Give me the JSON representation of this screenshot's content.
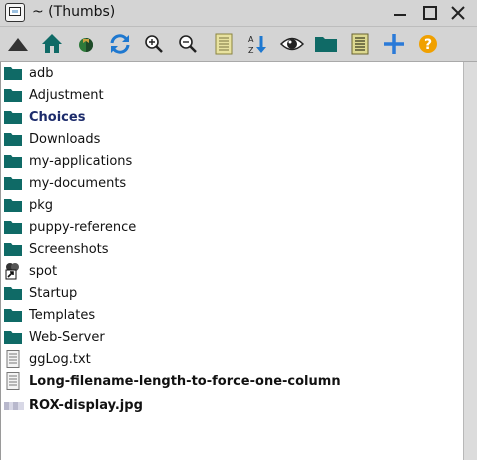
{
  "window": {
    "title": "~ (Thumbs)",
    "controls": [
      "minimize",
      "maximize",
      "close"
    ]
  },
  "toolbar": {
    "buttons": [
      {
        "name": "up-icon",
        "tooltip_hidden": true
      },
      {
        "name": "home-icon"
      },
      {
        "name": "bookmarks-icon"
      },
      {
        "name": "refresh-icon"
      },
      {
        "name": "zoom-in-icon"
      },
      {
        "name": "zoom-out-icon"
      },
      {
        "name": "list-view-icon"
      },
      {
        "name": "sort-icon",
        "glyph": "A Z"
      },
      {
        "name": "show-hidden-icon"
      },
      {
        "name": "folder-icon"
      },
      {
        "name": "details-icon"
      },
      {
        "name": "add-icon"
      },
      {
        "name": "help-icon",
        "glyph": "?"
      }
    ]
  },
  "files": [
    {
      "name": "adb",
      "type": "folder"
    },
    {
      "name": "Adjustment",
      "type": "folder"
    },
    {
      "name": "Choices",
      "type": "folder",
      "style": "bold-selected"
    },
    {
      "name": "Downloads",
      "type": "folder"
    },
    {
      "name": "my-applications",
      "type": "folder"
    },
    {
      "name": "my-documents",
      "type": "folder"
    },
    {
      "name": "pkg",
      "type": "folder"
    },
    {
      "name": "puppy-reference",
      "type": "folder"
    },
    {
      "name": "Screenshots",
      "type": "folder"
    },
    {
      "name": "spot",
      "type": "symlink"
    },
    {
      "name": "Startup",
      "type": "folder"
    },
    {
      "name": "Templates",
      "type": "folder"
    },
    {
      "name": "Web-Server",
      "type": "folder"
    },
    {
      "name": "ggLog.txt",
      "type": "text"
    },
    {
      "name": "Long-filename-length-to-force-one-column",
      "type": "text",
      "style": "bold"
    },
    {
      "name": "ROX-display.jpg",
      "type": "image",
      "style": "bold"
    }
  ],
  "colors": {
    "folder": "#0f6a66",
    "toolbar_bg": "#d4d4d4",
    "list_bg": "#ffffff",
    "refresh_blue": "#1e78d0",
    "help_orange": "#f0a000"
  }
}
